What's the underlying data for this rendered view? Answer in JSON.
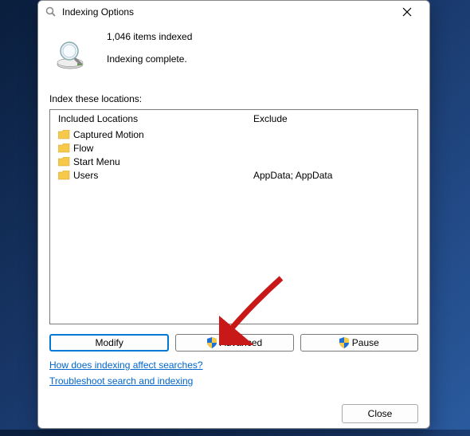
{
  "title": "Indexing Options",
  "status": {
    "count_text": "1,046 items indexed",
    "state_text": "Indexing complete."
  },
  "labels": {
    "index_locations": "Index these locations:",
    "included": "Included Locations",
    "exclude": "Exclude"
  },
  "locations": [
    {
      "name": "Captured Motion",
      "exclude": ""
    },
    {
      "name": "Flow",
      "exclude": ""
    },
    {
      "name": "Start Menu",
      "exclude": ""
    },
    {
      "name": "Users",
      "exclude": "AppData; AppData"
    }
  ],
  "buttons": {
    "modify": "Modify",
    "advanced": "Advanced",
    "pause": "Pause",
    "close": "Close"
  },
  "links": {
    "how_affect": "How does indexing affect searches?",
    "troubleshoot": "Troubleshoot search and indexing"
  }
}
